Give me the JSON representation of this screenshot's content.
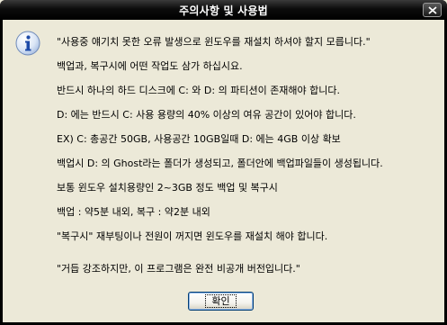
{
  "window": {
    "title": "주의사항 및 사용법",
    "close_icon": "close-icon"
  },
  "dialog": {
    "icon": "info-icon",
    "lines": [
      "\"사용중 얘기치 못한 오류 발생으로 윈도우를 재설치 하셔야 할지 모릅니다.\"",
      "백업과, 복구시에 어떤 작업도 삼가 하십시요.",
      "반드시 하나의 하드 디스크에 C: 와 D: 의 파티션이 존재해야 합니다.",
      "D: 에는 반드시 C: 사용 용량의 40% 이상의 여유 공간이 있어야 합니다.",
      "EX) C: 총공간 50GB, 사용공간 10GB일때 D: 에는 4GB 이상 확보",
      "백업시 D: 의 Ghost라는 폴더가 생성되고, 폴더안에 백업파일들이 생성됩니다.",
      "보통 윈도우 설치용량인 2~3GB 정도 백업 및 복구시",
      "백업 : 약5분 내외, 복구 : 약2분 내외",
      "\"복구시\" 재부팅이나 전원이 꺼지면 윈도우를 재설치 해야 합니다.",
      "\"거듭 강조하지만, 이 프로그램은 완전 비공개 버전입니다.\""
    ]
  },
  "buttons": {
    "ok_label": "확인"
  }
}
